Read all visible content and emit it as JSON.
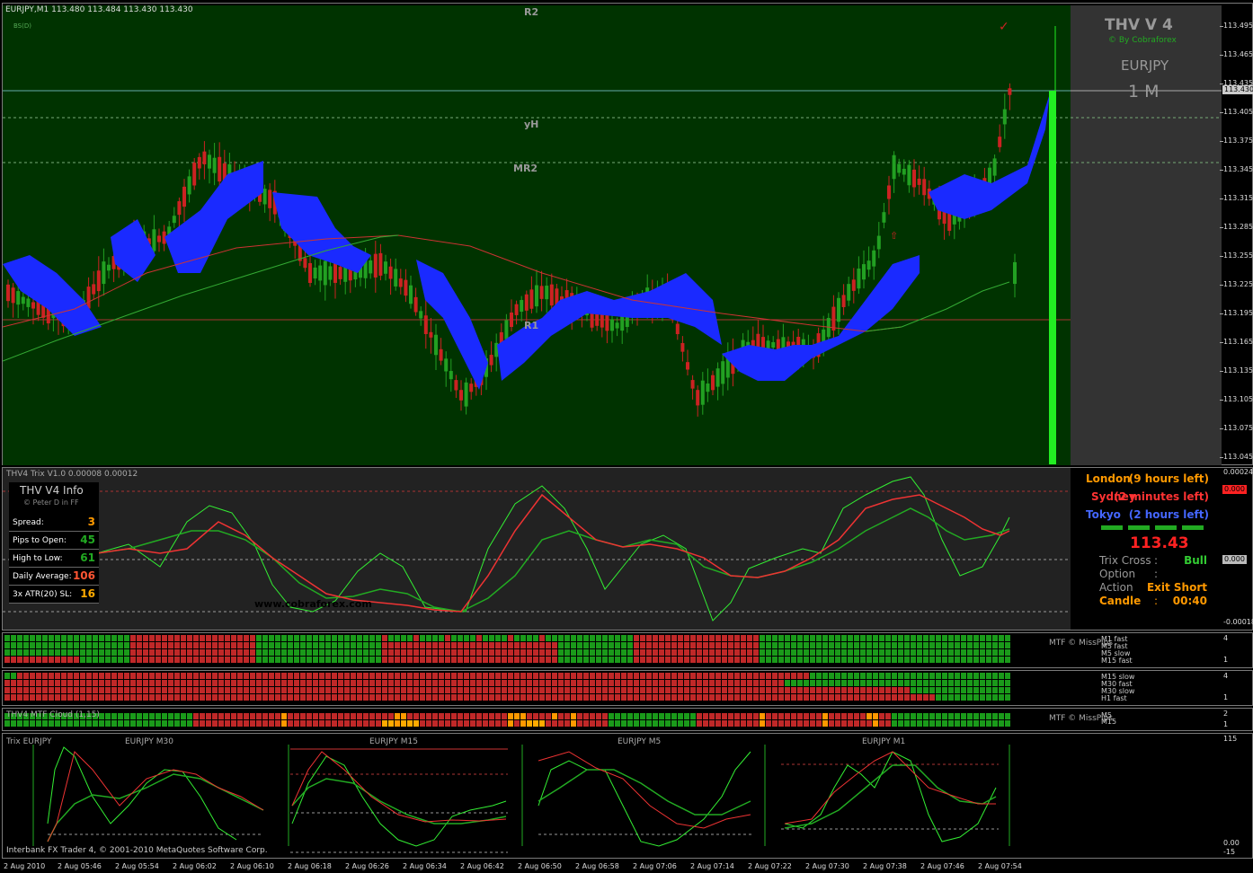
{
  "main_chart": {
    "symbol_header": "EURJPY,M1  113.480 113.484 113.430 113.430",
    "sub_label": "BS(D)",
    "levels": {
      "r2": "R2",
      "yh": "yH",
      "mr2": "MR2",
      "r1": "R1"
    },
    "price_axis": [
      "113.495",
      "113.465",
      "113.435",
      "113.405",
      "113.375",
      "113.345",
      "113.315",
      "113.285",
      "113.255",
      "113.225",
      "113.195",
      "113.165",
      "113.135",
      "113.105",
      "113.075",
      "113.045"
    ],
    "current_price_badge": "113.430",
    "panel_title": "THV V 4",
    "panel_subtitle": "© By Cobraforex",
    "panel_symbol": "EURJPY",
    "panel_timeframe": "1 M"
  },
  "trix_pane": {
    "header": "THV4 Trix V1.0 0.00008 0.00012",
    "axis_top": "0.00024",
    "axis_mid": "0.000",
    "axis_bottom": "-0.00018",
    "badge_red": "0.000",
    "badge_gray": "0.000",
    "website": "www.cobraforex.com",
    "info": {
      "title": "THV  V4  Info",
      "subtitle": "© Peter D  in FF",
      "rows": [
        {
          "label": "Spread:",
          "value": "3",
          "color": "#ff9900"
        },
        {
          "label": "Pips to Open:",
          "value": "45",
          "color": "#22aa22"
        },
        {
          "label": "High to Low:",
          "value": "61",
          "color": "#22aa22"
        },
        {
          "label": "Daily Average:",
          "value": "106",
          "color": "#ff5533"
        },
        {
          "label": "3x ATR(20) SL:",
          "value": "16",
          "color": "#ffaa00"
        }
      ]
    },
    "sessions": [
      {
        "name": "London",
        "time": "(9 hours left)",
        "color": "#ff9900"
      },
      {
        "name": "Sydney",
        "time": "(2 minutes left)",
        "color": "#ff3333"
      },
      {
        "name": "Tokyo",
        "time": "(2 hours left)",
        "color": "#4466ff"
      }
    ],
    "big_price": "113.43",
    "status": [
      {
        "label": "Trix Cross",
        "sep": ":",
        "value": "Bull",
        "label_color": "#999",
        "value_color": "#33cc33"
      },
      {
        "label": "Option",
        "sep": ":",
        "value": "",
        "label_color": "#999",
        "value_color": "#999"
      },
      {
        "label": "Action",
        "sep": ":",
        "value": "Exit Short",
        "label_color": "#999",
        "value_color": "#ff9900"
      },
      {
        "label": "Candle",
        "sep": ":",
        "value": "00:40",
        "label_color": "#ff9900",
        "value_color": "#ff9900"
      }
    ]
  },
  "mtf1": {
    "label": "MTF © MissPips",
    "rows": [
      "M1 fast",
      "M5 fast",
      "M5 slow",
      "M15 fast"
    ],
    "axis": [
      "4",
      "1"
    ]
  },
  "mtf2": {
    "rows": [
      "M15 slow",
      "M30 fast",
      "M30 slow",
      "H1 fast"
    ],
    "axis": [
      "4",
      "1"
    ]
  },
  "mtf3": {
    "header": "THV4 MTF Cloud (1,15)",
    "label": "MTF © MissPips",
    "rows": [
      "M5",
      "M15"
    ],
    "axis": [
      "2",
      "1"
    ]
  },
  "bottom_pane": {
    "header": "Trix EURJPY",
    "charts": [
      "EURJPY M30",
      "EURJPY M15",
      "EURJPY M5",
      "EURJPY M1"
    ],
    "axis_top": "115",
    "axis_b1": "0.00",
    "axis_b2": "-15",
    "copyright": "Interbank FX Trader 4, © 2001-2010 MetaQuotes Software Corp."
  },
  "time_axis": [
    "2 Aug 2010",
    "2 Aug 05:46",
    "2 Aug 05:54",
    "2 Aug 06:02",
    "2 Aug 06:10",
    "2 Aug 06:18",
    "2 Aug 06:26",
    "2 Aug 06:34",
    "2 Aug 06:42",
    "2 Aug 06:50",
    "2 Aug 06:58",
    "2 Aug 07:06",
    "2 Aug 07:14",
    "2 Aug 07:22",
    "2 Aug 07:30",
    "2 Aug 07:38",
    "2 Aug 07:46",
    "2 Aug 07:54"
  ],
  "colors": {
    "bull": "#22a022",
    "bear": "#cc2222",
    "cloud": "#1a2aff",
    "bg_main": "#003300",
    "bg_dark": "#222222",
    "panel": "#333333"
  }
}
